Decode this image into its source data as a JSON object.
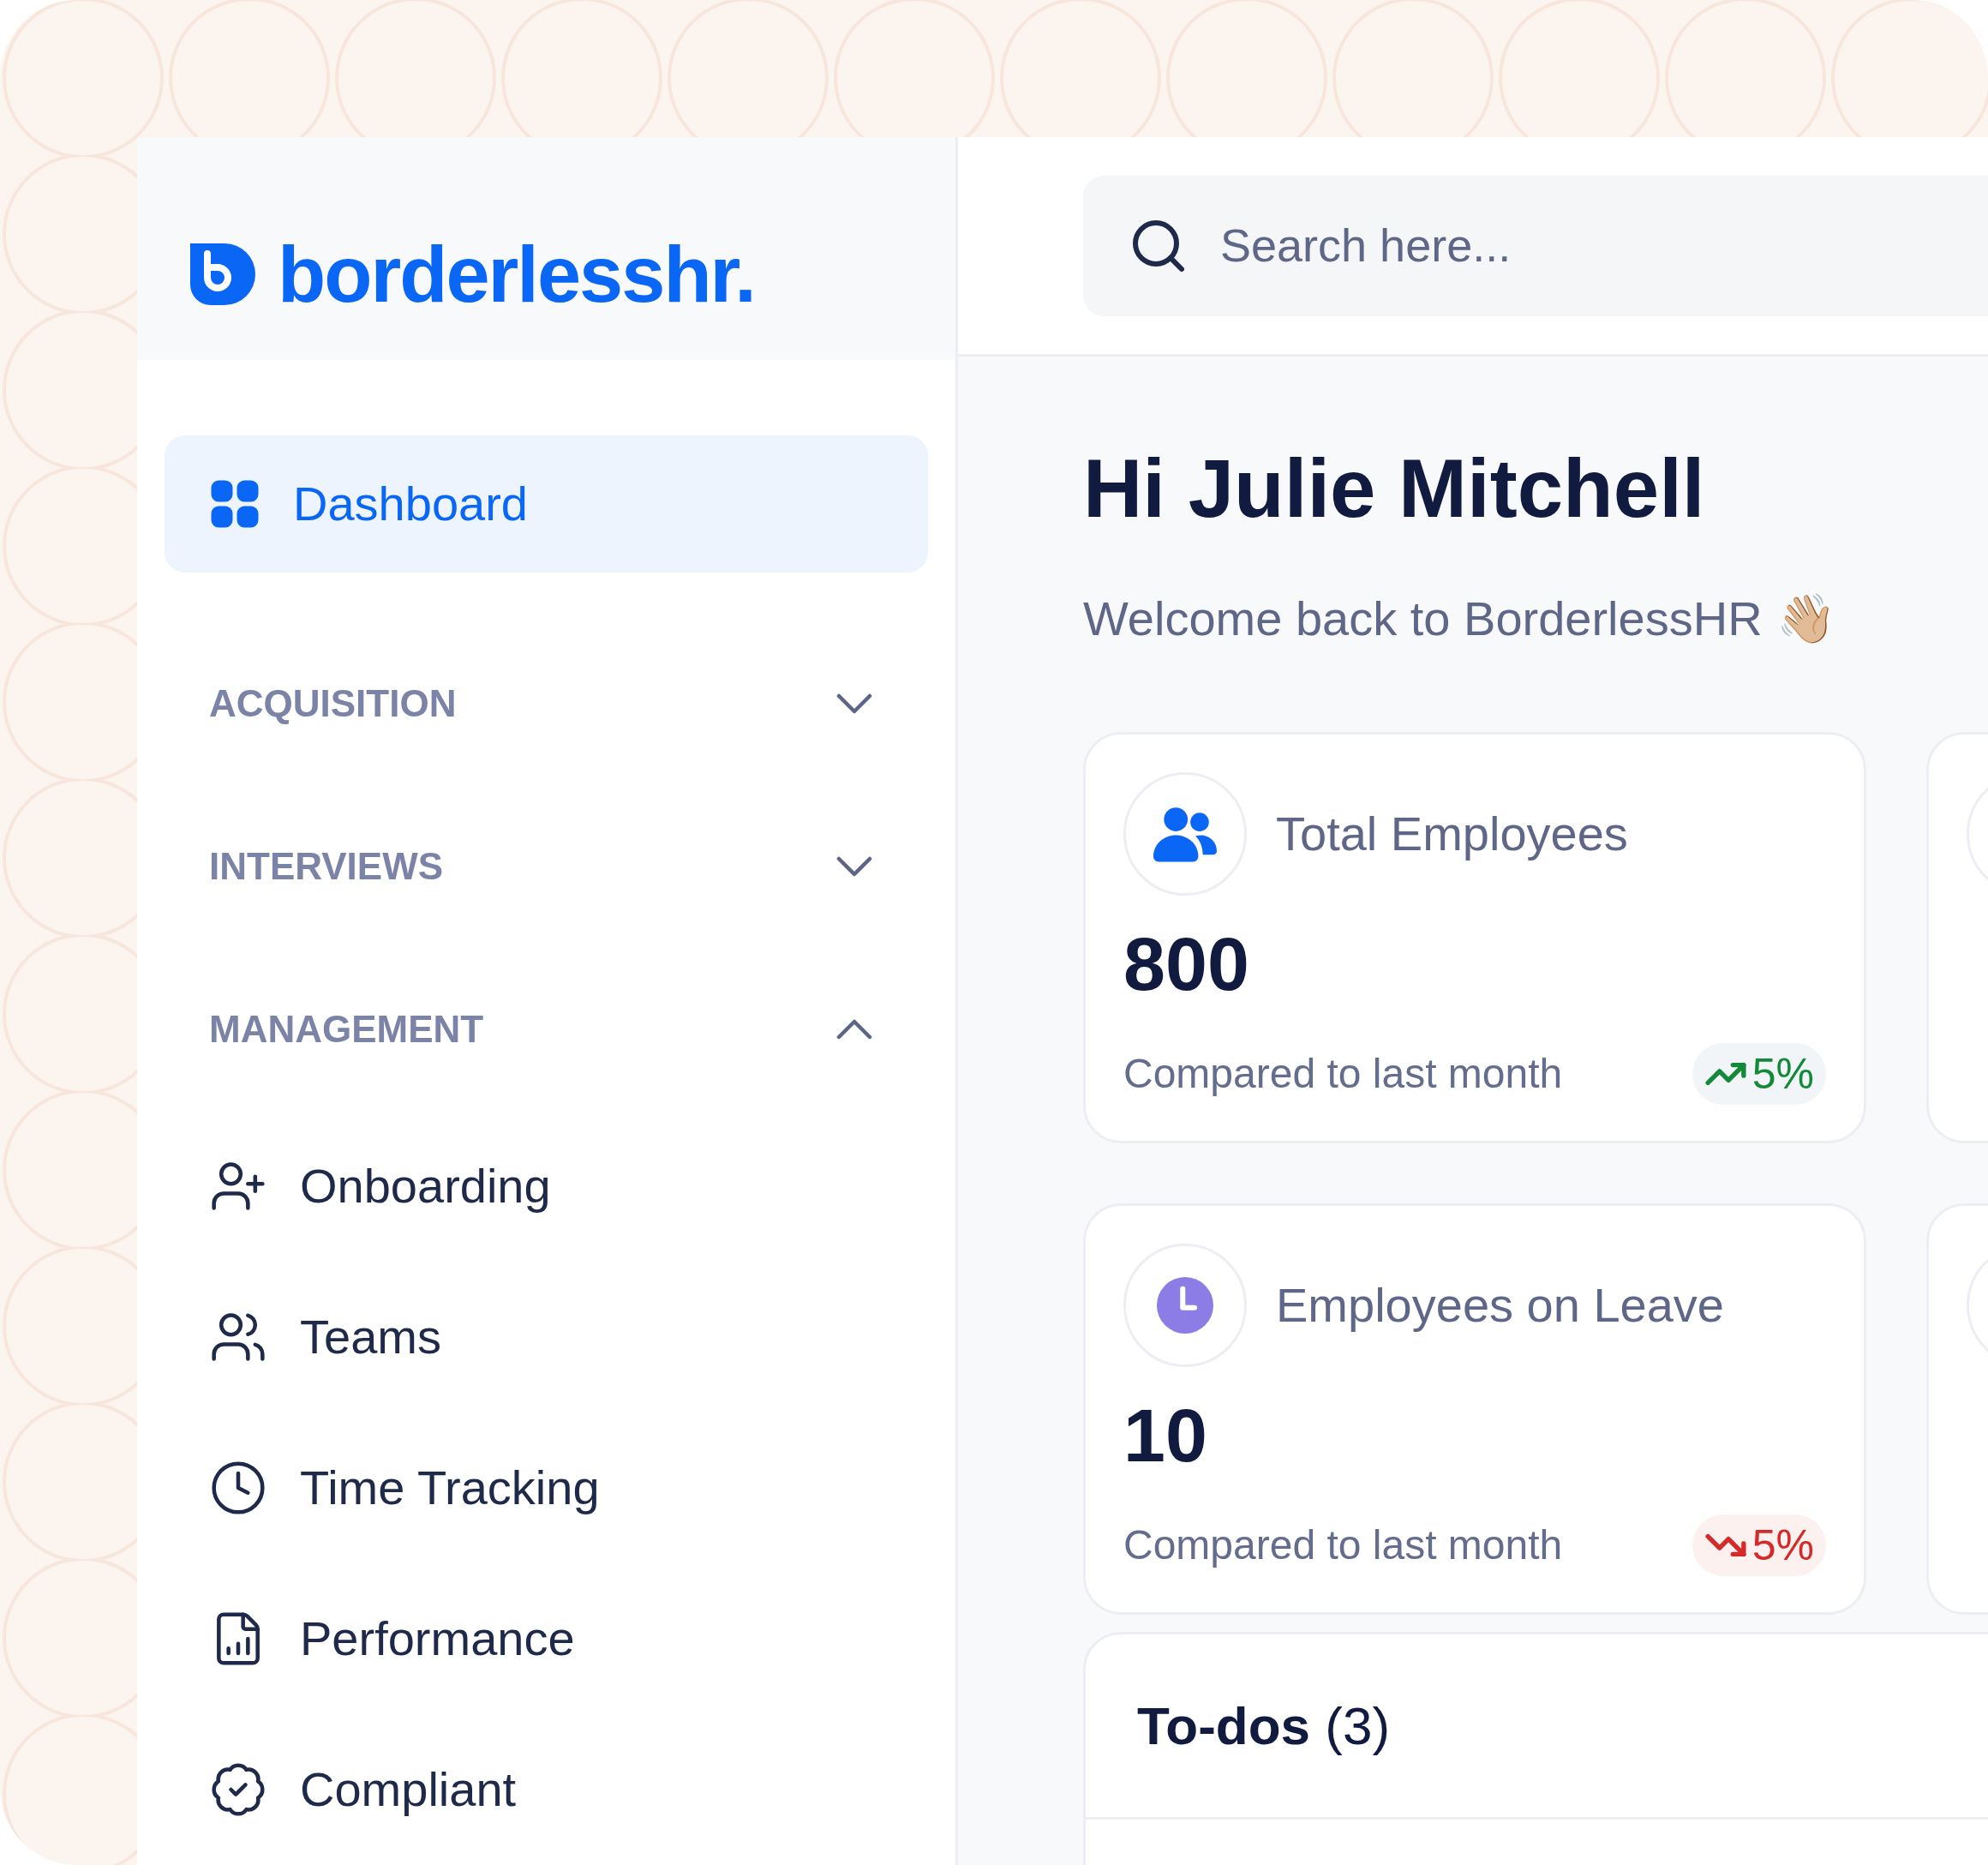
{
  "logo": {
    "text": "borderlesshr."
  },
  "nav": [
    {
      "kind": "link",
      "label": "Dashboard",
      "selected": true
    },
    {
      "kind": "section",
      "label": "ACQUISITION",
      "expanded": false
    },
    {
      "kind": "section",
      "label": "INTERVIEWS",
      "expanded": false
    },
    {
      "kind": "section",
      "label": "MANAGEMENT",
      "expanded": true,
      "children": [
        {
          "label": "Onboarding",
          "kind": "onboarding",
          "selected": false
        },
        {
          "label": "Teams",
          "kind": "teams",
          "selected": false
        },
        {
          "label": "Time Tracking",
          "kind": "tracking",
          "selected": false
        },
        {
          "label": "Performance",
          "kind": "performance",
          "selected": false
        },
        {
          "label": "Compliant",
          "kind": "compliance",
          "selected": false
        }
      ]
    }
  ],
  "search": {
    "placeholder": "Search here..."
  },
  "greeting": {
    "title": "Hi Julie Mitchell",
    "subtitle": "Welcome back to BorderlessHR",
    "emoji": "👋🏼"
  },
  "stats": [
    {
      "kind": "people",
      "label": "Total Employees",
      "value": "800",
      "caption": "Compared to last month",
      "rising": true,
      "change": "5%"
    },
    {
      "kind": "leave",
      "label": "Employees on Leave",
      "value": "10",
      "caption": "Compared to last month",
      "rising": false,
      "change": "5%"
    }
  ],
  "todos": {
    "title": "To-dos",
    "count": "(3)"
  }
}
